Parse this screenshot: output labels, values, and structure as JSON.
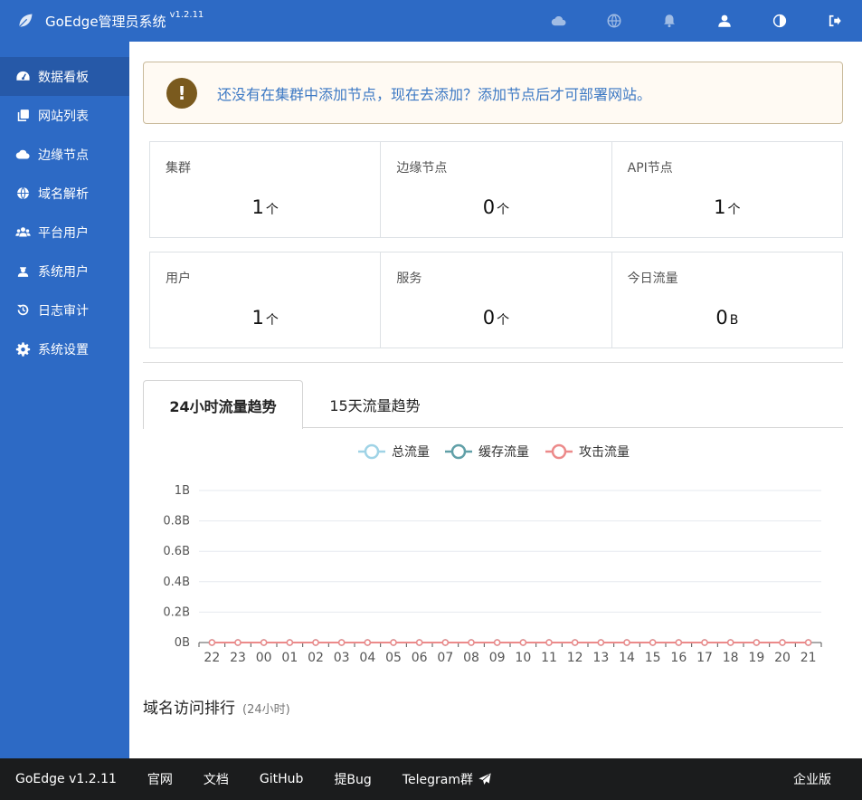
{
  "header": {
    "title": "GoEdge管理员系统",
    "version": "v1.2.11",
    "icons": [
      "cloud-icon",
      "globe-icon",
      "bell-icon",
      "user-icon",
      "contrast-icon",
      "logout-icon"
    ]
  },
  "sidebar": {
    "items": [
      {
        "label": "数据看板",
        "icon": "dashboard-icon"
      },
      {
        "label": "网站列表",
        "icon": "copy-icon"
      },
      {
        "label": "边缘节点",
        "icon": "cloud-icon"
      },
      {
        "label": "域名解析",
        "icon": "globe-icon"
      },
      {
        "label": "平台用户",
        "icon": "users-icon"
      },
      {
        "label": "系统用户",
        "icon": "admin-user-icon"
      },
      {
        "label": "日志审计",
        "icon": "history-icon"
      },
      {
        "label": "系统设置",
        "icon": "gear-icon"
      }
    ],
    "active_index": 0
  },
  "alert": {
    "message": "还没有在集群中添加节点，现在去添加？添加节点后才可部署网站。",
    "icon": "exclamation-icon"
  },
  "stats_row1": [
    {
      "label": "集群",
      "value": "1",
      "unit": "个"
    },
    {
      "label": "边缘节点",
      "value": "0",
      "unit": "个"
    },
    {
      "label": "API节点",
      "value": "1",
      "unit": "个"
    }
  ],
  "stats_row2": [
    {
      "label": "用户",
      "value": "1",
      "unit": "个"
    },
    {
      "label": "服务",
      "value": "0",
      "unit": "个"
    },
    {
      "label": "今日流量",
      "value": "0",
      "unit": "B"
    }
  ],
  "tabs": [
    {
      "label": "24小时流量趋势",
      "active": true
    },
    {
      "label": "15天流量趋势",
      "active": false
    }
  ],
  "chart_data": {
    "type": "line",
    "x": [
      "22",
      "23",
      "00",
      "01",
      "02",
      "03",
      "04",
      "05",
      "06",
      "07",
      "08",
      "09",
      "10",
      "11",
      "12",
      "13",
      "14",
      "15",
      "16",
      "17",
      "18",
      "19",
      "20",
      "21"
    ],
    "series": [
      {
        "name": "总流量",
        "color": "#9fd3e6",
        "values": [
          0,
          0,
          0,
          0,
          0,
          0,
          0,
          0,
          0,
          0,
          0,
          0,
          0,
          0,
          0,
          0,
          0,
          0,
          0,
          0,
          0,
          0,
          0,
          0
        ]
      },
      {
        "name": "缓存流量",
        "color": "#61a0a8",
        "values": [
          0,
          0,
          0,
          0,
          0,
          0,
          0,
          0,
          0,
          0,
          0,
          0,
          0,
          0,
          0,
          0,
          0,
          0,
          0,
          0,
          0,
          0,
          0,
          0
        ]
      },
      {
        "name": "攻击流量",
        "color": "#ec8a8a",
        "values": [
          0,
          0,
          0,
          0,
          0,
          0,
          0,
          0,
          0,
          0,
          0,
          0,
          0,
          0,
          0,
          0,
          0,
          0,
          0,
          0,
          0,
          0,
          0,
          0
        ]
      }
    ],
    "yticks": [
      "0B",
      "0.2B",
      "0.4B",
      "0.6B",
      "0.8B",
      "1B"
    ],
    "ylim": [
      0,
      1
    ],
    "grid": true,
    "legend": "top-center"
  },
  "section": {
    "title": "域名访问排行",
    "subtitle": "(24小时)"
  },
  "footer": {
    "links": [
      "GoEdge v1.2.11",
      "官网",
      "文档",
      "GitHub",
      "提Bug",
      "Telegram群"
    ],
    "right": "企业版"
  }
}
